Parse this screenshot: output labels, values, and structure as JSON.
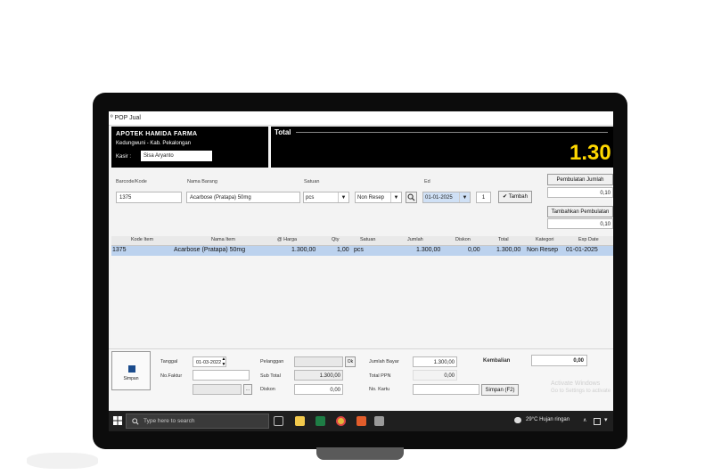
{
  "window": {
    "title": "º POP Jual"
  },
  "store": {
    "name": "APOTEK HAMIDA FARMA",
    "address": "Kedungwuni - Kab. Pekalongan",
    "kasir_label": "Kasir :",
    "kasir_value": "Sisa Aryanto"
  },
  "total": {
    "label": "Total",
    "value": "1.30"
  },
  "entry": {
    "barcode_label": "Barcode/Kode",
    "barcode_value": "1375",
    "nama_label": "Nama Barang",
    "nama_value": "Acarbose (Pratapa) 50mg",
    "satuan_label": "Satuan",
    "satuan_value": "pcs",
    "jenis_value": "Non Resep",
    "ed_label": "Ed",
    "ed_value": "01-01-2025",
    "qty_value": "1",
    "tambah_label": "Tambah"
  },
  "side": {
    "btn1": "Pembulatan Jumlah",
    "val1": "0,10",
    "btn2": "Tambahkan Pembulatan",
    "val2": "0,10"
  },
  "grid": {
    "columns": [
      "Kode Item",
      "Nama Item",
      "@ Harga",
      "Qty",
      "Satuan",
      "Jumlah",
      "Diskon",
      "Total",
      "Kategori",
      "Exp Date"
    ],
    "rows": [
      {
        "kode": "1375",
        "nama": "Acarbose (Pratapa) 50mg",
        "harga": "1.300,00",
        "qty": "1,00",
        "satuan": "pcs",
        "jumlah": "1.300,00",
        "diskon": "0,00",
        "total": "1.300,00",
        "kategori": "Non Resep",
        "exp": "01-01-2025"
      }
    ]
  },
  "footer": {
    "simpan": "Simpan",
    "tanggal_label": "Tanggal",
    "tanggal_value": "01-03-2022",
    "nofaktur_label": "No.Faktur",
    "pelanggan_label": "Pelanggan",
    "pelanggan_btn": "Ok",
    "subtotal_label": "Sub Total",
    "subtotal_value": "1.300,00",
    "diskon_label": "Diskon",
    "diskon_value": "0,00",
    "jumlahbayar_label": "Jumlah Bayar",
    "jumlahbayar_value": "1.300,00",
    "totalppn_label": "Total PPN",
    "totalppn_value": "0,00",
    "nokartu_label": "No. Kartu",
    "kembalian_label": "Kembalian",
    "kembalian_value": "0,00",
    "simpan_btn": "Simpan (F2)",
    "activate1": "Activate Windows",
    "activate2": "Go to Settings to activate"
  },
  "taskbar": {
    "search_placeholder": "Type here to search",
    "weather": "29°C  Hujan ringan"
  },
  "colors": {
    "accent_total": "#ffd800",
    "selected_row": "#bcd2ee",
    "header_bg": "#000000"
  }
}
